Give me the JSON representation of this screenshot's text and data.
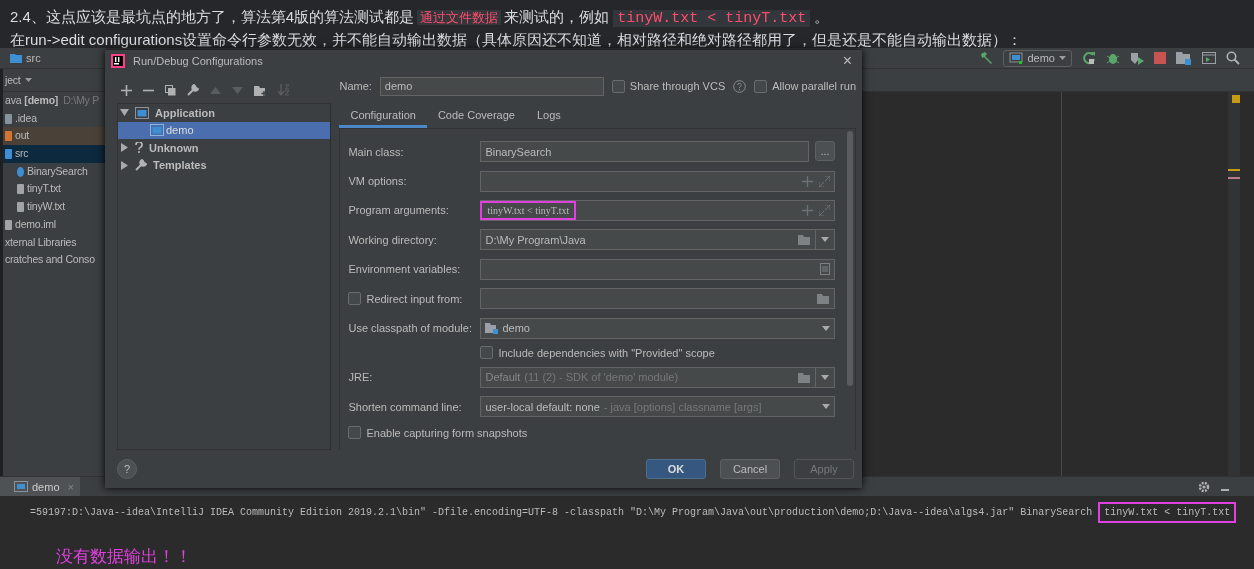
{
  "article": {
    "paragraphs": [
      {
        "segments": [
          {
            "kind": "text",
            "text": "2.4、这点应该是最坑点的地方了，算法第4版的算法测试都是"
          },
          {
            "kind": "mark",
            "text": "通过文件数据"
          },
          {
            "kind": "text",
            "text": "来测试的，例如"
          },
          {
            "kind": "code",
            "text": "tinyW.txt < tinyT.txt"
          },
          {
            "kind": "text",
            "text": "。"
          }
        ]
      },
      {
        "segments": [
          {
            "kind": "text",
            "text": "在run->edit configurations设置命令行参数无效，并不能自动输出数据（具体原因还不知道，相对路径和绝对路径都用了，但是还是不能自动输出数据）："
          }
        ]
      }
    ]
  },
  "ide": {
    "breadcrumb": "src",
    "project_view": "ject",
    "tree": [
      {
        "kind": "root",
        "name": "ava",
        "bold": "[demo]",
        "path": "D:\\My P",
        "selected": false
      },
      {
        "kind": "folder",
        "name": ".idea",
        "selected": false
      },
      {
        "kind": "excluded",
        "name": "out",
        "selected": false
      },
      {
        "kind": "source",
        "name": "src",
        "selected": true
      },
      {
        "kind": "class",
        "name": "BinarySearch",
        "selected": false
      },
      {
        "kind": "file",
        "name": "tinyT.txt",
        "selected": false
      },
      {
        "kind": "file",
        "name": "tinyW.txt",
        "selected": false
      },
      {
        "kind": "module",
        "name": "demo.iml",
        "selected": false
      },
      {
        "kind": "library",
        "name": "xternal Libraries",
        "selected": false
      },
      {
        "kind": "library",
        "name": "cratches and Conso",
        "selected": false
      }
    ],
    "run_config": "demo",
    "run_tab": {
      "label": "demo",
      "close": "×"
    },
    "console": {
      "command": "=59197:D:\\Java--idea\\IntelliJ IDEA Community Edition 2019.2.1\\bin\" -Dfile.encoding=UTF-8 -classpath \"D:\\My Program\\Java\\out\\production\\demo;D:\\Java--idea\\algs4.jar\" BinarySearch",
      "arguments": "tinyW.txt < tinyT.txt",
      "highlighted": true
    },
    "annotation": "没有数据输出！！"
  },
  "dialog": {
    "title": "Run/Debug Configurations",
    "close": "×",
    "tree": [
      {
        "label": "Application",
        "kind": "application",
        "expanded": true,
        "children": [
          {
            "label": "demo",
            "selected": true
          }
        ]
      },
      {
        "label": "Unknown",
        "kind": "unknown",
        "expanded": false
      },
      {
        "label": "Templates",
        "kind": "templates",
        "expanded": false
      }
    ],
    "name_label": "Name:",
    "name": "demo",
    "options": [
      {
        "label": "Share through VCS",
        "checked": false,
        "help": true
      },
      {
        "label": "Allow parallel run",
        "checked": false,
        "help": false
      }
    ],
    "tabs": [
      {
        "label": "Configuration",
        "selected": true
      },
      {
        "label": "Code Coverage",
        "selected": false
      },
      {
        "label": "Logs",
        "selected": false
      }
    ],
    "rows": [
      {
        "kind": "browse",
        "label": "Main class:",
        "value": "BinarySearch",
        "button": "..."
      },
      {
        "kind": "expandable",
        "label": "VM options:"
      },
      {
        "kind": "expandable",
        "label": "Program arguments:",
        "value": "tinyW.txt < tinyT.txt",
        "highlighted": true
      },
      {
        "kind": "directory",
        "label": "Working directory:",
        "value": "D:\\My Program\\Java"
      },
      {
        "kind": "env",
        "label": "Environment variables:"
      },
      {
        "kind": "redirect",
        "label": "Redirect input from:",
        "checked": false
      },
      {
        "kind": "module",
        "label": "Use classpath of module:",
        "value": "demo"
      },
      {
        "kind": "checkbox",
        "label": "Include dependencies with \"Provided\" scope",
        "checked": false
      },
      {
        "kind": "jre",
        "label": "JRE:",
        "value": "Default",
        "hint": "(11 (2) - SDK of 'demo' module)"
      },
      {
        "kind": "select",
        "label": "Shorten command line:",
        "value": "user-local default: none",
        "hint": "- java [options] classname [args]"
      },
      {
        "kind": "snapshot",
        "label": "Enable capturing form snapshots",
        "checked": false
      }
    ],
    "help": "?",
    "buttons": [
      {
        "label": "OK",
        "kind": "default",
        "disabled": false
      },
      {
        "label": "Cancel",
        "kind": "normal",
        "disabled": false
      },
      {
        "label": "Apply",
        "kind": "normal",
        "disabled": true
      }
    ]
  }
}
